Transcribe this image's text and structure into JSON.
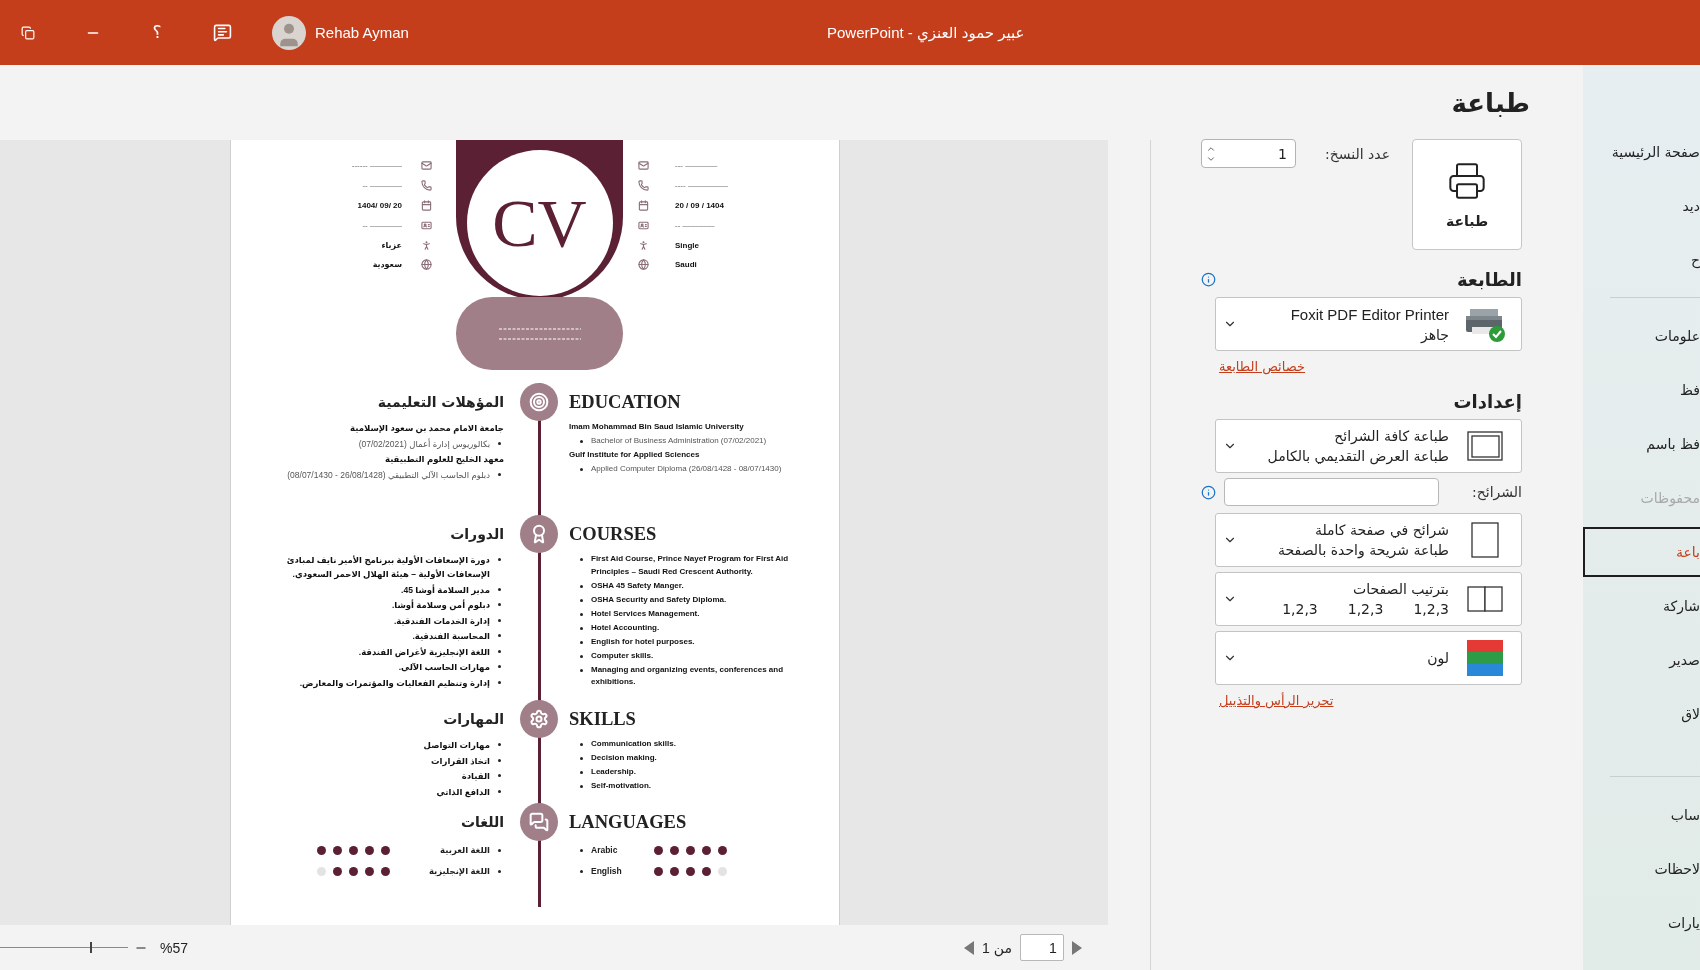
{
  "title_bar": {
    "help": "؟",
    "user_name": "Rehab Ayman",
    "title": "عبير حمود العنزي - PowerPoint"
  },
  "print_panel": {
    "title": "طباعة",
    "print_button": "طباعة",
    "copies_label": "عدد النسخ:",
    "copies_value": "1",
    "printer_heading": "الطابعة",
    "printer": {
      "name": "Foxit PDF Editor Printer",
      "status": "جاهز"
    },
    "printer_link": "خصائص الطابعة",
    "settings_heading": "إعدادات",
    "slides_label": "الشرائح:",
    "settings": [
      {
        "primary": "طباعة كافة الشرائح",
        "secondary": "طباعة العرض التقديمي بالكامل"
      },
      {
        "primary": "شرائح في صفحة كاملة",
        "secondary": "طباعة شريحة واحدة بالصفحة"
      },
      {
        "primary": "بترتيب الصفحات",
        "collation": [
          "1,2,3",
          "1,2,3",
          "1,2,3"
        ]
      },
      {
        "primary": "لون"
      }
    ],
    "footer_link": "تحرير الرأس والتذييل"
  },
  "cv": {
    "monogram": "CV",
    "info_ar": [
      "------ ————",
      "-- ————",
      "1404/ 09/ 20",
      "-- ————",
      "عزباء",
      "سعودية"
    ],
    "info_en": [
      "--- ————",
      "---- —————",
      "20 / 09 / 1404",
      "-- ————",
      "Single",
      "Saudi"
    ],
    "sections": [
      {
        "heading_en": "EDUCATION",
        "heading_ar": "المؤهلات التعليمية",
        "en": [
          {
            "kind": "title",
            "text": "Imam Mohammad Bin Saud Islamic University"
          },
          {
            "kind": "detail",
            "text": "Bachelor of Business Administration (07/02/2021)"
          },
          {
            "kind": "title",
            "text": "Gulf Institute for Applied Sciences"
          },
          {
            "kind": "detail",
            "text": "Applied Computer Diploma (26/08/1428 - 08/07/1430)"
          }
        ],
        "ar": [
          {
            "kind": "title",
            "text": "جامعة الامام محمد بن سعود الإسلامية"
          },
          {
            "kind": "detail",
            "text": "بكالوريوس إدارة أعمال (07/02/2021)"
          },
          {
            "kind": "title",
            "text": "معهد الخليج للعلوم التطبيقية"
          },
          {
            "kind": "detail",
            "text": "دبلوم الحاسب الآلي التطبيقي (26/08/1428 - 08/07/1430)"
          }
        ]
      },
      {
        "heading_en": "COURSES",
        "heading_ar": "الدورات",
        "en": [
          {
            "kind": "bullet",
            "text": "First Aid Course, Prince Nayef Program for First Aid Principles – Saudi Red Crescent Authority."
          },
          {
            "kind": "bullet",
            "text": "OSHA 45 Safety Manger."
          },
          {
            "kind": "bullet",
            "text": "OSHA Security and Safety Diploma."
          },
          {
            "kind": "bullet",
            "text": "Hotel Services Management."
          },
          {
            "kind": "bullet",
            "text": "Hotel Accounting."
          },
          {
            "kind": "bullet",
            "text": "English for hotel purposes."
          },
          {
            "kind": "bullet",
            "text": "Computer skills."
          },
          {
            "kind": "bullet",
            "text": "Managing and organizing events, conferences and exhibitions."
          }
        ],
        "ar": [
          {
            "kind": "bullet",
            "text": "دورة الإسعافات الأولية ببرنامج الأمير نايف لمبادئ الإسعافات الأولية – هيئة الهلال الاحمر السعودي."
          },
          {
            "kind": "bullet",
            "text": "مدير السلامة أوشا 45."
          },
          {
            "kind": "bullet",
            "text": "دبلوم أمن وسلامة أوشا."
          },
          {
            "kind": "bullet",
            "text": "إدارة الخدمات الفندقية."
          },
          {
            "kind": "bullet",
            "text": "المحاسبة الفندقية."
          },
          {
            "kind": "bullet",
            "text": "اللغة الإنجليزية لأغراض الفندقة."
          },
          {
            "kind": "bullet",
            "text": "مهارات الحاسب الآلي."
          },
          {
            "kind": "bullet",
            "text": "إدارة وتنظيم الفعاليات والمؤتمرات والمعارض."
          }
        ]
      },
      {
        "heading_en": "SKILLS",
        "heading_ar": "المهارات",
        "en": [
          {
            "kind": "bullet",
            "text": "Communication skills."
          },
          {
            "kind": "bullet",
            "text": "Decision making."
          },
          {
            "kind": "bullet",
            "text": "Leadership."
          },
          {
            "kind": "bullet",
            "text": "Self-motivation."
          }
        ],
        "ar": [
          {
            "kind": "bullet",
            "text": "مهارات التواصل"
          },
          {
            "kind": "bullet",
            "text": "اتخاذ القرارات"
          },
          {
            "kind": "bullet",
            "text": "القيادة"
          },
          {
            "kind": "bullet",
            "text": "الدافع الذاتي"
          }
        ]
      },
      {
        "heading_en": "LANGUAGES",
        "heading_ar": "اللغات",
        "en": [
          {
            "kind": "rating",
            "text": "Arabic",
            "stars": 5
          },
          {
            "kind": "rating",
            "text": "English",
            "stars": 4
          }
        ],
        "ar": [
          {
            "kind": "rating",
            "text": "اللغة العربية",
            "stars": 5
          },
          {
            "kind": "rating",
            "text": "اللغة الإنجليزية",
            "stars": 4
          }
        ]
      }
    ]
  },
  "status_bar": {
    "zoom": "%57",
    "zoom_slider": {
      "level": 0.7
    },
    "page_label": "من 1",
    "page_value": "1"
  },
  "nav": {
    "groups": [
      {
        "items": [
          {
            "label": "صفحة الرئيسية",
            "selected": false,
            "disabled": false
          },
          {
            "label": "ديد",
            "selected": false,
            "disabled": false
          },
          {
            "label": "ح",
            "selected": false,
            "disabled": false
          }
        ]
      },
      {
        "items": [
          {
            "label": "علومات",
            "selected": false,
            "disabled": false
          },
          {
            "label": "فظ",
            "selected": false,
            "disabled": false
          },
          {
            "label": "فظ باسم",
            "selected": false,
            "disabled": false
          },
          {
            "label": "محفوظات",
            "selected": false,
            "disabled": true
          },
          {
            "label": "باعة",
            "selected": true,
            "disabled": false
          },
          {
            "label": "شاركة",
            "selected": false,
            "disabled": false
          },
          {
            "label": "صدير",
            "selected": false,
            "disabled": false
          },
          {
            "label": "لاق",
            "selected": false,
            "disabled": false
          }
        ]
      },
      {
        "items": [
          {
            "label": "ساب",
            "selected": false,
            "disabled": false
          },
          {
            "label": "لاحظات",
            "selected": false,
            "disabled": false
          },
          {
            "label": "يارات",
            "selected": false,
            "disabled": false
          }
        ]
      }
    ]
  }
}
